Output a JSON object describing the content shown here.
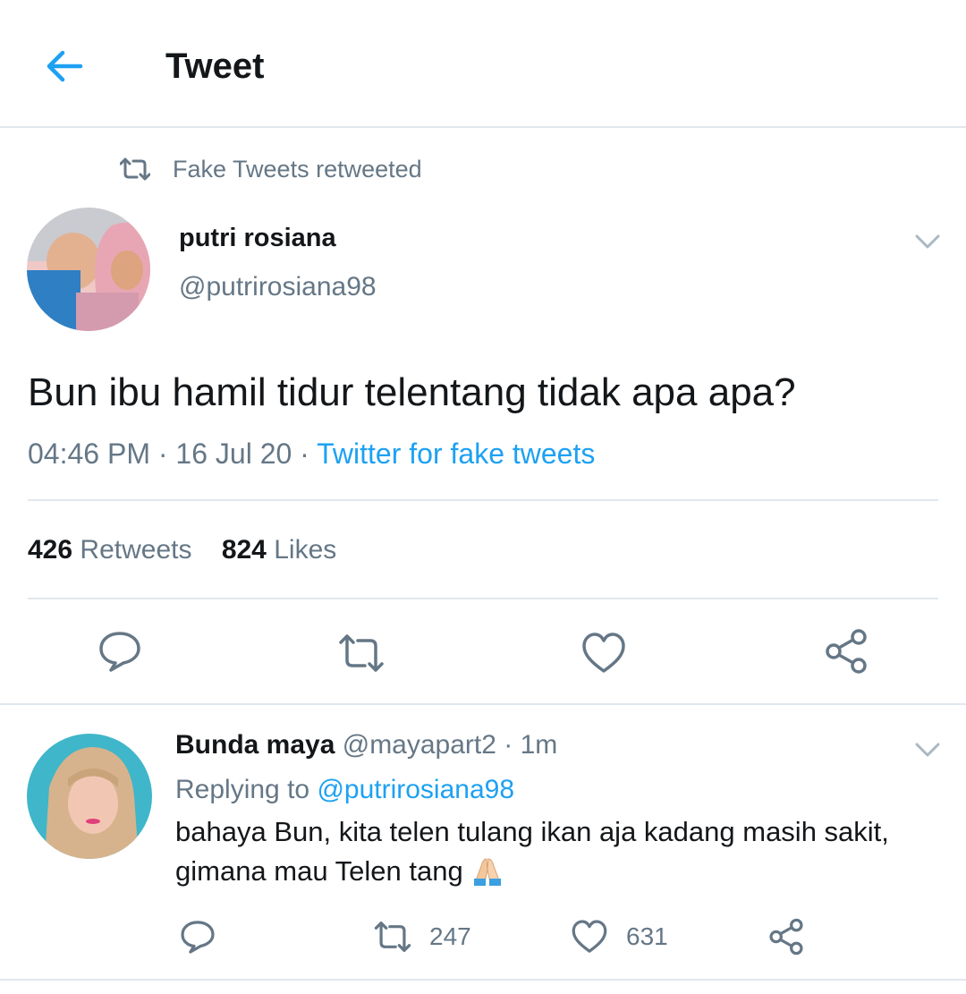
{
  "header": {
    "title": "Tweet"
  },
  "retweet_context": {
    "text": "Fake Tweets retweeted"
  },
  "tweet": {
    "author_name": "putri rosiana",
    "author_handle": "@putrirosiana98",
    "text": "Bun ibu hamil tidur telentang tidak apa apa?",
    "time": "04:46 PM",
    "date": "16 Jul 20",
    "source": "Twitter for fake tweets",
    "retweets_count": "426",
    "retweets_label": "Retweets",
    "likes_count": "824",
    "likes_label": "Likes"
  },
  "reply": {
    "author_name": "Bunda maya",
    "author_handle": "@mayapart2",
    "time": "1m",
    "replying_prefix": "Replying to",
    "replying_to": "@putrirosiana98",
    "text_line1": "bahaya Bun, kita telen tulang ikan aja kadang masih sakit,",
    "text_line2": "gimana mau Telen tang",
    "retweets": "247",
    "likes": "631"
  },
  "colors": {
    "accent": "#1da1f2",
    "muted": "#657786",
    "divider": "#e1e8ed"
  }
}
